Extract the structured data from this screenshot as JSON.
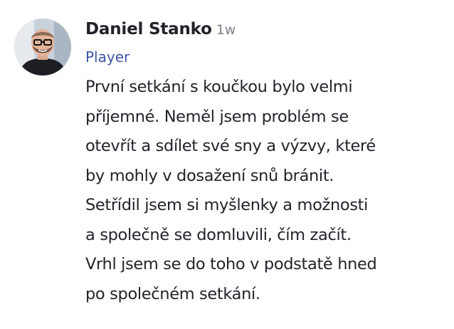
{
  "comment": {
    "author": "Daniel Stanko",
    "time": "1w",
    "role": "Player",
    "message": "První setkání s koučkou bylo velmi\npříjemné. Neměl jsem problém se\notevřít a sdílet své sny a výzvy, které\nby mohly v dosažení snů bránit.\nSetřídil jsem si myšlenky a možnosti\na společně se domluvili, čím začít.\nVrhl jsem se do toho v podstatě hned\npo společném setkání.",
    "avatar_icon": "user-avatar-photo"
  },
  "colors": {
    "author": "#22222a",
    "time": "#7c7f88",
    "role": "#3f55a6",
    "message": "#23232b"
  }
}
